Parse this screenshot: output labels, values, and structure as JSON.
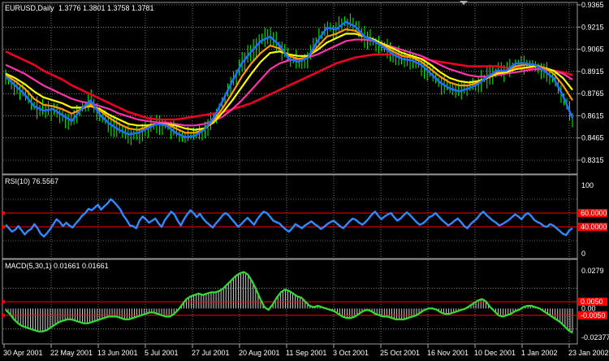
{
  "main": {
    "header": {
      "symbol": "EURUSD,Daily",
      "open": "1.3776",
      "high": "1.3801",
      "low": "1.3758",
      "close": "1.3781"
    },
    "price_axis": [
      "0.9365",
      "0.9215",
      "0.9065",
      "0.8915",
      "0.8765",
      "0.8615",
      "0.8465",
      "0.8315"
    ],
    "ylim": [
      0.8315,
      0.9365
    ],
    "candles_color": "#00ff00",
    "series": [
      {
        "key": "blue",
        "color": "#1e6eff",
        "values": [
          0.888,
          0.882,
          0.876,
          0.868,
          0.865,
          0.866,
          0.862,
          0.858,
          0.866,
          0.872,
          0.862,
          0.856,
          0.852,
          0.849,
          0.85,
          0.853,
          0.856,
          0.855,
          0.85,
          0.847,
          0.848,
          0.852,
          0.86,
          0.872,
          0.885,
          0.897,
          0.905,
          0.912,
          0.915,
          0.909,
          0.9,
          0.898,
          0.901,
          0.912,
          0.921,
          0.92,
          0.925,
          0.922,
          0.915,
          0.912,
          0.908,
          0.903,
          0.9,
          0.899,
          0.896,
          0.89,
          0.884,
          0.88,
          0.878,
          0.88,
          0.883,
          0.888,
          0.892,
          0.892,
          0.897,
          0.897,
          0.896,
          0.892,
          0.887,
          0.875,
          0.86
        ]
      },
      {
        "key": "orange",
        "color": "#ff9900",
        "values": [
          0.889,
          0.885,
          0.88,
          0.873,
          0.869,
          0.868,
          0.866,
          0.863,
          0.866,
          0.869,
          0.865,
          0.86,
          0.856,
          0.853,
          0.852,
          0.854,
          0.856,
          0.856,
          0.853,
          0.85,
          0.85,
          0.852,
          0.858,
          0.867,
          0.877,
          0.888,
          0.897,
          0.904,
          0.909,
          0.907,
          0.902,
          0.9,
          0.901,
          0.908,
          0.915,
          0.917,
          0.92,
          0.919,
          0.915,
          0.912,
          0.909,
          0.905,
          0.902,
          0.901,
          0.898,
          0.893,
          0.888,
          0.884,
          0.882,
          0.882,
          0.884,
          0.887,
          0.891,
          0.892,
          0.895,
          0.896,
          0.896,
          0.894,
          0.89,
          0.882,
          0.872
        ]
      },
      {
        "key": "yellow",
        "color": "#ffff00",
        "values": [
          0.89,
          0.887,
          0.883,
          0.878,
          0.874,
          0.872,
          0.87,
          0.867,
          0.867,
          0.868,
          0.866,
          0.862,
          0.859,
          0.856,
          0.855,
          0.855,
          0.856,
          0.856,
          0.855,
          0.853,
          0.852,
          0.853,
          0.857,
          0.864,
          0.872,
          0.881,
          0.89,
          0.898,
          0.904,
          0.905,
          0.903,
          0.902,
          0.902,
          0.906,
          0.911,
          0.914,
          0.917,
          0.917,
          0.915,
          0.913,
          0.91,
          0.907,
          0.904,
          0.902,
          0.9,
          0.896,
          0.891,
          0.887,
          0.885,
          0.884,
          0.885,
          0.887,
          0.89,
          0.891,
          0.893,
          0.894,
          0.895,
          0.894,
          0.892,
          0.887,
          0.879
        ]
      },
      {
        "key": "magenta",
        "color": "#ff33aa",
        "values": [
          0.896,
          0.893,
          0.89,
          0.886,
          0.882,
          0.879,
          0.876,
          0.873,
          0.871,
          0.87,
          0.868,
          0.866,
          0.863,
          0.861,
          0.859,
          0.858,
          0.857,
          0.857,
          0.856,
          0.855,
          0.855,
          0.856,
          0.858,
          0.861,
          0.866,
          0.872,
          0.879,
          0.886,
          0.893,
          0.897,
          0.899,
          0.9,
          0.901,
          0.903,
          0.906,
          0.909,
          0.912,
          0.913,
          0.913,
          0.912,
          0.91,
          0.908,
          0.906,
          0.904,
          0.902,
          0.899,
          0.896,
          0.893,
          0.891,
          0.889,
          0.888,
          0.888,
          0.889,
          0.89,
          0.891,
          0.892,
          0.893,
          0.893,
          0.892,
          0.89,
          0.886
        ]
      },
      {
        "key": "red",
        "color": "#ee0022",
        "values": [
          0.905,
          0.902,
          0.899,
          0.896,
          0.892,
          0.889,
          0.886,
          0.882,
          0.879,
          0.876,
          0.873,
          0.87,
          0.867,
          0.864,
          0.862,
          0.86,
          0.859,
          0.859,
          0.859,
          0.86,
          0.861,
          0.862,
          0.863,
          0.864,
          0.866,
          0.868,
          0.87,
          0.873,
          0.876,
          0.879,
          0.882,
          0.885,
          0.888,
          0.891,
          0.894,
          0.897,
          0.899,
          0.901,
          0.902,
          0.903,
          0.903,
          0.903,
          0.902,
          0.901,
          0.9,
          0.899,
          0.898,
          0.897,
          0.896,
          0.895,
          0.895,
          0.895,
          0.895,
          0.894,
          0.894,
          0.894,
          0.893,
          0.893,
          0.892,
          0.891,
          0.889
        ]
      }
    ]
  },
  "rsi": {
    "header": "RSI(10) 76.5567",
    "axis": [
      "100",
      "0"
    ],
    "levels": [
      {
        "value": 60,
        "label": "60.0000"
      },
      {
        "value": 40,
        "label": "40.0000"
      }
    ],
    "color": "#2e8bff",
    "level_color": "#ff0000",
    "values": [
      43,
      38,
      33,
      36,
      41,
      35,
      29,
      34,
      37,
      44,
      38,
      30,
      26,
      31,
      37,
      44,
      51,
      47,
      41,
      46,
      42,
      39,
      45,
      50,
      56,
      60,
      66,
      64,
      68,
      72,
      65,
      70,
      74,
      80,
      76,
      71,
      65,
      56,
      50,
      42,
      41,
      38,
      49,
      55,
      51,
      46,
      49,
      52,
      45,
      40,
      50,
      56,
      62,
      58,
      49,
      42,
      51,
      58,
      64,
      60,
      54,
      59,
      52,
      47,
      43,
      39,
      45,
      50,
      56,
      60,
      57,
      51,
      46,
      40,
      44,
      49,
      53,
      48,
      43,
      51,
      57,
      62,
      60,
      55,
      49,
      47,
      45,
      40,
      36,
      33,
      38,
      44,
      41,
      38,
      42,
      45,
      48,
      44,
      41,
      37,
      40,
      44,
      47,
      49,
      45,
      41,
      38,
      43,
      48,
      52,
      50,
      46,
      43,
      47,
      52,
      58,
      62,
      56,
      51,
      55,
      58,
      60,
      54,
      49,
      52,
      57,
      61,
      57,
      52,
      47,
      43,
      45,
      49,
      54,
      56,
      60,
      55,
      50,
      46,
      42,
      45,
      49,
      52,
      47,
      41,
      38,
      44,
      48,
      52,
      58,
      62,
      57,
      53,
      49,
      46,
      42,
      44,
      47,
      50,
      54,
      58,
      55,
      51,
      57,
      60,
      56,
      50,
      47,
      45,
      41,
      40,
      44,
      42,
      38,
      34,
      30,
      28,
      35,
      38
    ]
  },
  "macd": {
    "header": "MACD(5,30,1) 0.01661 0.01661",
    "axis": [
      "0.0279",
      "0.00",
      "-0.02377"
    ],
    "ylim": [
      -0.02377,
      0.0279
    ],
    "levels": [
      {
        "value": 0.005,
        "label": "0.0050"
      },
      {
        "value": -0.005,
        "label": "-0.0050"
      }
    ],
    "line_color": "#33dd33",
    "hist_color": "#cccccc",
    "level_color": "#ff0000",
    "values": [
      -0.001,
      -0.004,
      -0.008,
      -0.011,
      -0.013,
      -0.014,
      -0.015,
      -0.016,
      -0.017,
      -0.017,
      -0.016,
      -0.014,
      -0.012,
      -0.01,
      -0.009,
      -0.008,
      -0.008,
      -0.009,
      -0.01,
      -0.011,
      -0.011,
      -0.01,
      -0.009,
      -0.008,
      -0.007,
      -0.006,
      -0.006,
      -0.006,
      -0.007,
      -0.008,
      -0.008,
      -0.007,
      -0.006,
      -0.005,
      -0.004,
      -0.003,
      -0.003,
      -0.004,
      -0.005,
      -0.006,
      -0.006,
      -0.004,
      -0.001,
      0.003,
      0.007,
      0.009,
      0.01,
      0.011,
      0.01,
      0.011,
      0.012,
      0.012,
      0.013,
      0.015,
      0.018,
      0.021,
      0.024,
      0.026,
      0.027,
      0.025,
      0.02,
      0.014,
      0.007,
      0.001,
      -0.001,
      0.003,
      0.008,
      0.012,
      0.014,
      0.013,
      0.011,
      0.009,
      0.008,
      0.005,
      0.002,
      0.001,
      0.002,
      0.001,
      0.0,
      -0.001,
      -0.002,
      -0.004,
      -0.006,
      -0.007,
      -0.007,
      -0.006,
      -0.004,
      -0.002,
      -0.001,
      -0.002,
      -0.004,
      -0.005,
      -0.006,
      -0.006,
      -0.007,
      -0.008,
      -0.008,
      -0.008,
      -0.007,
      -0.006,
      -0.005,
      -0.003,
      -0.001,
      0.0,
      0.0,
      -0.001,
      -0.003,
      -0.004,
      -0.004,
      -0.003,
      -0.002,
      -0.001,
      0.0,
      0.002,
      0.004,
      0.006,
      0.007,
      0.005,
      0.001,
      -0.002,
      -0.005,
      -0.006,
      -0.005,
      -0.004,
      -0.002,
      -0.001,
      0.001,
      0.002,
      0.002,
      0.001,
      0.0,
      -0.002,
      -0.004,
      -0.006,
      -0.008,
      -0.01,
      -0.013,
      -0.016,
      -0.018
    ]
  },
  "x_axis": [
    "30 Apr 2001",
    "22 May 2001",
    "13 Jun 2001",
    "5 Jul 2001",
    "27 Jul 2001",
    "20 Aug 2001",
    "11 Sep 2001",
    "3 Oct 2001",
    "25 Oct 2001",
    "16 Nov 2001",
    "10 Dec 2001",
    "1 Jan 2002",
    "23 Jan 2002"
  ],
  "grid_color": "#c8c8c8"
}
